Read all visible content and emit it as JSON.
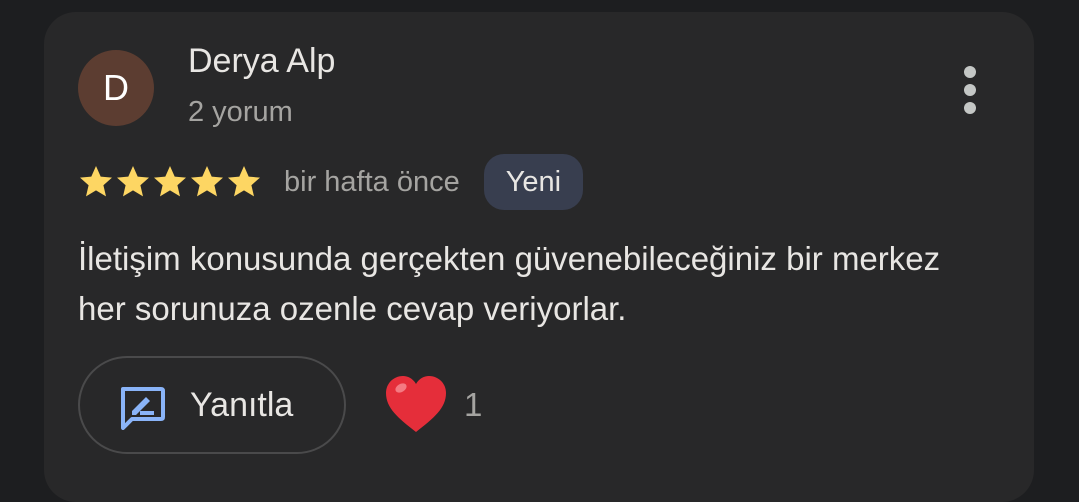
{
  "review": {
    "author": {
      "initial": "D",
      "name": "Derya Alp",
      "review_count": "2 yorum"
    },
    "rating": 5,
    "rating_max": 5,
    "time_ago": "bir hafta önce",
    "badge": "Yeni",
    "text": "İletişim konusunda gerçekten güvenebileceğiniz bir merkez her sorunuza ozenle cevap veriyorlar.",
    "reply_label": "Yanıtla",
    "like_count": "1"
  },
  "icons": {
    "more": "more-vertical-icon",
    "reply": "reply-icon",
    "like": "heart-icon",
    "star": "star-icon"
  },
  "colors": {
    "background": "#1d1e20",
    "card": "#282829",
    "avatar": "#5c3d31",
    "star": "#fdd663",
    "badge": "#383e4f",
    "reply_icon": "#8ab4f8",
    "heart": "#e52e3a"
  }
}
